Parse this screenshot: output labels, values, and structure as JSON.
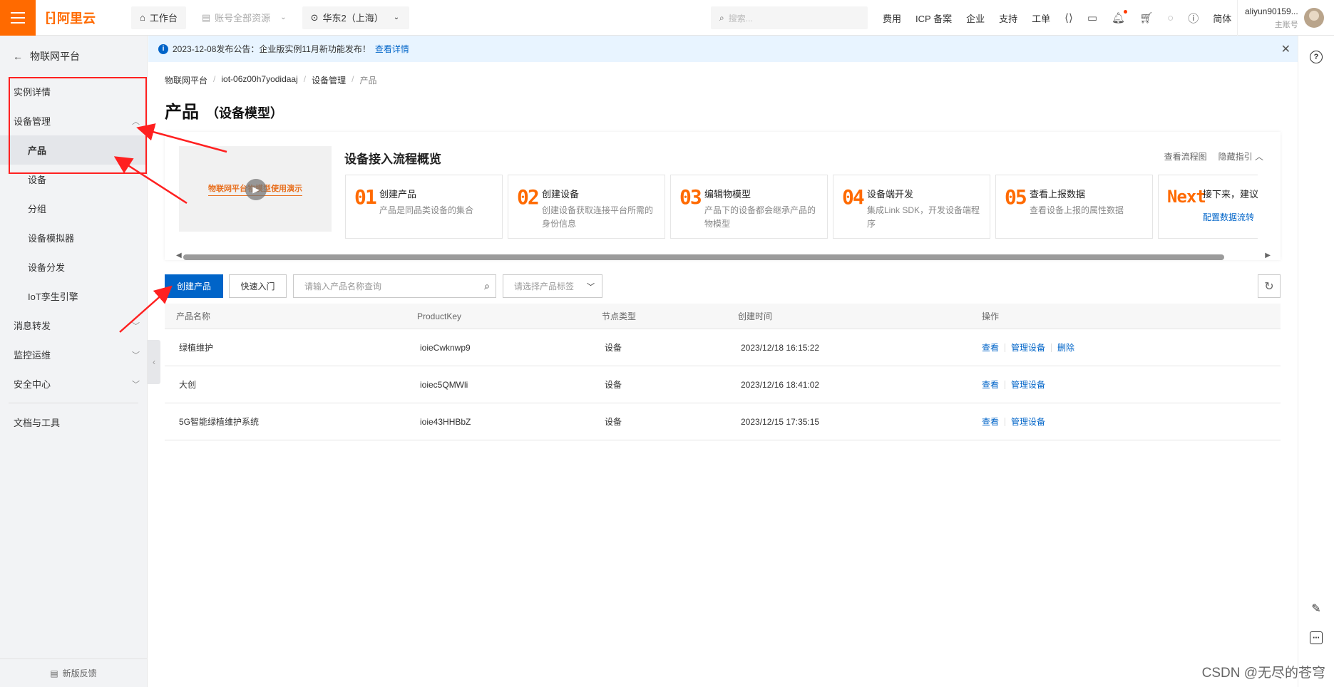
{
  "topbar": {
    "logo_text": "阿里云",
    "workbench": "工作台",
    "resources": "账号全部资源",
    "region": "华东2（上海）",
    "search_placeholder": "搜索...",
    "nav": [
      "费用",
      "ICP 备案",
      "企业",
      "支持",
      "工单"
    ],
    "language": "简体",
    "account_name": "aliyun90159...",
    "account_role": "主账号"
  },
  "sidebar": {
    "back": "物联网平台",
    "items": [
      {
        "label": "实例详情",
        "level": 1
      },
      {
        "label": "设备管理",
        "level": 1,
        "expanded": true
      },
      {
        "label": "产品",
        "level": 2,
        "active": true
      },
      {
        "label": "设备",
        "level": 2
      },
      {
        "label": "分组",
        "level": 2
      },
      {
        "label": "设备模拟器",
        "level": 2
      },
      {
        "label": "设备分发",
        "level": 2
      },
      {
        "label": "IoT孪生引擎",
        "level": 2
      },
      {
        "label": "消息转发",
        "level": 1
      },
      {
        "label": "监控运维",
        "level": 1
      },
      {
        "label": "安全中心",
        "level": 1
      },
      {
        "label": "文档与工具",
        "level": 1
      }
    ],
    "feedback": "新版反馈"
  },
  "notice": {
    "text": "2023-12-08发布公告：企业版实例11月新功能发布！",
    "link": "查看详情"
  },
  "breadcrumb": [
    "物联网平台",
    "iot-06z00h7yodidaaj",
    "设备管理",
    "产品"
  ],
  "page": {
    "title": "产品",
    "subtitle": "（设备模型）"
  },
  "guide": {
    "video_title": "物联网平台物模型使用演示",
    "title": "设备接入流程概览",
    "link_flow": "查看流程图",
    "link_hide": "隐藏指引",
    "steps": [
      {
        "num": "01",
        "title": "创建产品",
        "desc": "产品是同品类设备的集合"
      },
      {
        "num": "02",
        "title": "创建设备",
        "desc": "创建设备获取连接平台所需的身份信息"
      },
      {
        "num": "03",
        "title": "编辑物模型",
        "desc": "产品下的设备都会继承产品的物模型"
      },
      {
        "num": "04",
        "title": "设备端开发",
        "desc": "集成Link SDK，开发设备端程序"
      },
      {
        "num": "05",
        "title": "查看上报数据",
        "desc": "查看设备上报的属性数据"
      }
    ],
    "next": {
      "num": "Next",
      "title": "接下来，建议您配",
      "link": "配置数据流转"
    }
  },
  "toolbar": {
    "create": "创建产品",
    "quickstart": "快速入门",
    "search_placeholder": "请输入产品名称查询",
    "tag_placeholder": "请选择产品标签"
  },
  "table": {
    "headers": [
      "产品名称",
      "ProductKey",
      "节点类型",
      "创建时间",
      "操作"
    ],
    "rows": [
      {
        "name": "绿植维护",
        "key": "ioieCwknwp9",
        "node": "设备",
        "time": "2023/12/18 16:15:22",
        "actions": [
          "查看",
          "管理设备",
          "删除"
        ]
      },
      {
        "name": "大创",
        "key": "ioiec5QMWli",
        "node": "设备",
        "time": "2023/12/16 18:41:02",
        "actions": [
          "查看",
          "管理设备"
        ]
      },
      {
        "name": "5G智能绿植维护系统",
        "key": "ioie43HHBbZ",
        "node": "设备",
        "time": "2023/12/15 17:35:15",
        "actions": [
          "查看",
          "管理设备"
        ]
      }
    ]
  },
  "watermark": "CSDN @无尽的苍穹",
  "colors": {
    "brand": "#ff6a00",
    "primary": "#0064c8",
    "annotation": "#ff2020"
  }
}
